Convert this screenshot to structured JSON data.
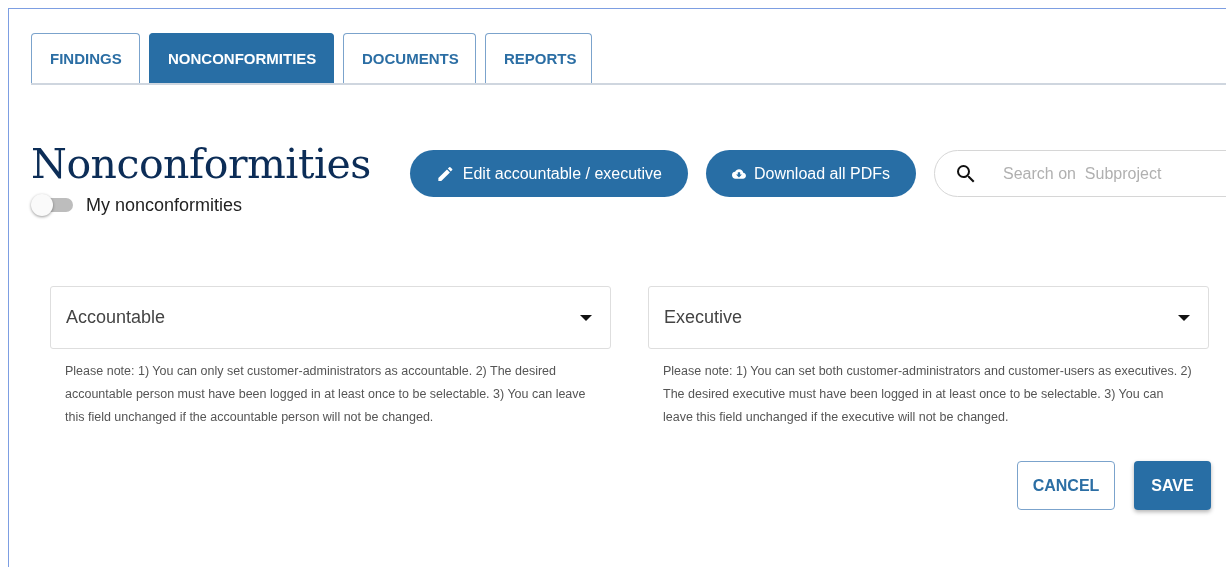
{
  "tabs": [
    {
      "label": "FINDINGS",
      "selected": false
    },
    {
      "label": "NONCONFORMITIES",
      "selected": true
    },
    {
      "label": "DOCUMENTS",
      "selected": false
    },
    {
      "label": "REPORTS",
      "selected": false
    }
  ],
  "heading": "Nonconformities",
  "my_toggle": {
    "label": "My nonconformities",
    "on": false
  },
  "actions": [
    {
      "kind": "edit",
      "label": "Edit accountable / executive"
    },
    {
      "kind": "download",
      "label": "Download all PDFs"
    }
  ],
  "search": {
    "placeholder": "Search on  Subproject"
  },
  "selects": [
    {
      "label": "Accountable",
      "note": "Please note: 1) You can only set customer-administrators as accountable. 2) The desired accountable person must have been logged in at least once to be selectable. 3) You can leave this field unchanged if the accountable person will not be changed."
    },
    {
      "label": "Executive",
      "note": "Please note: 1) You can set both customer-administrators and customer-users as executives. 2) The desired executive must have been logged in at least once to be selectable. 3) You can leave this field unchanged if the executive will not be changed."
    }
  ],
  "buttons": [
    {
      "kind": "secondary",
      "label": "CANCEL"
    },
    {
      "kind": "primary",
      "label": "SAVE"
    }
  ]
}
